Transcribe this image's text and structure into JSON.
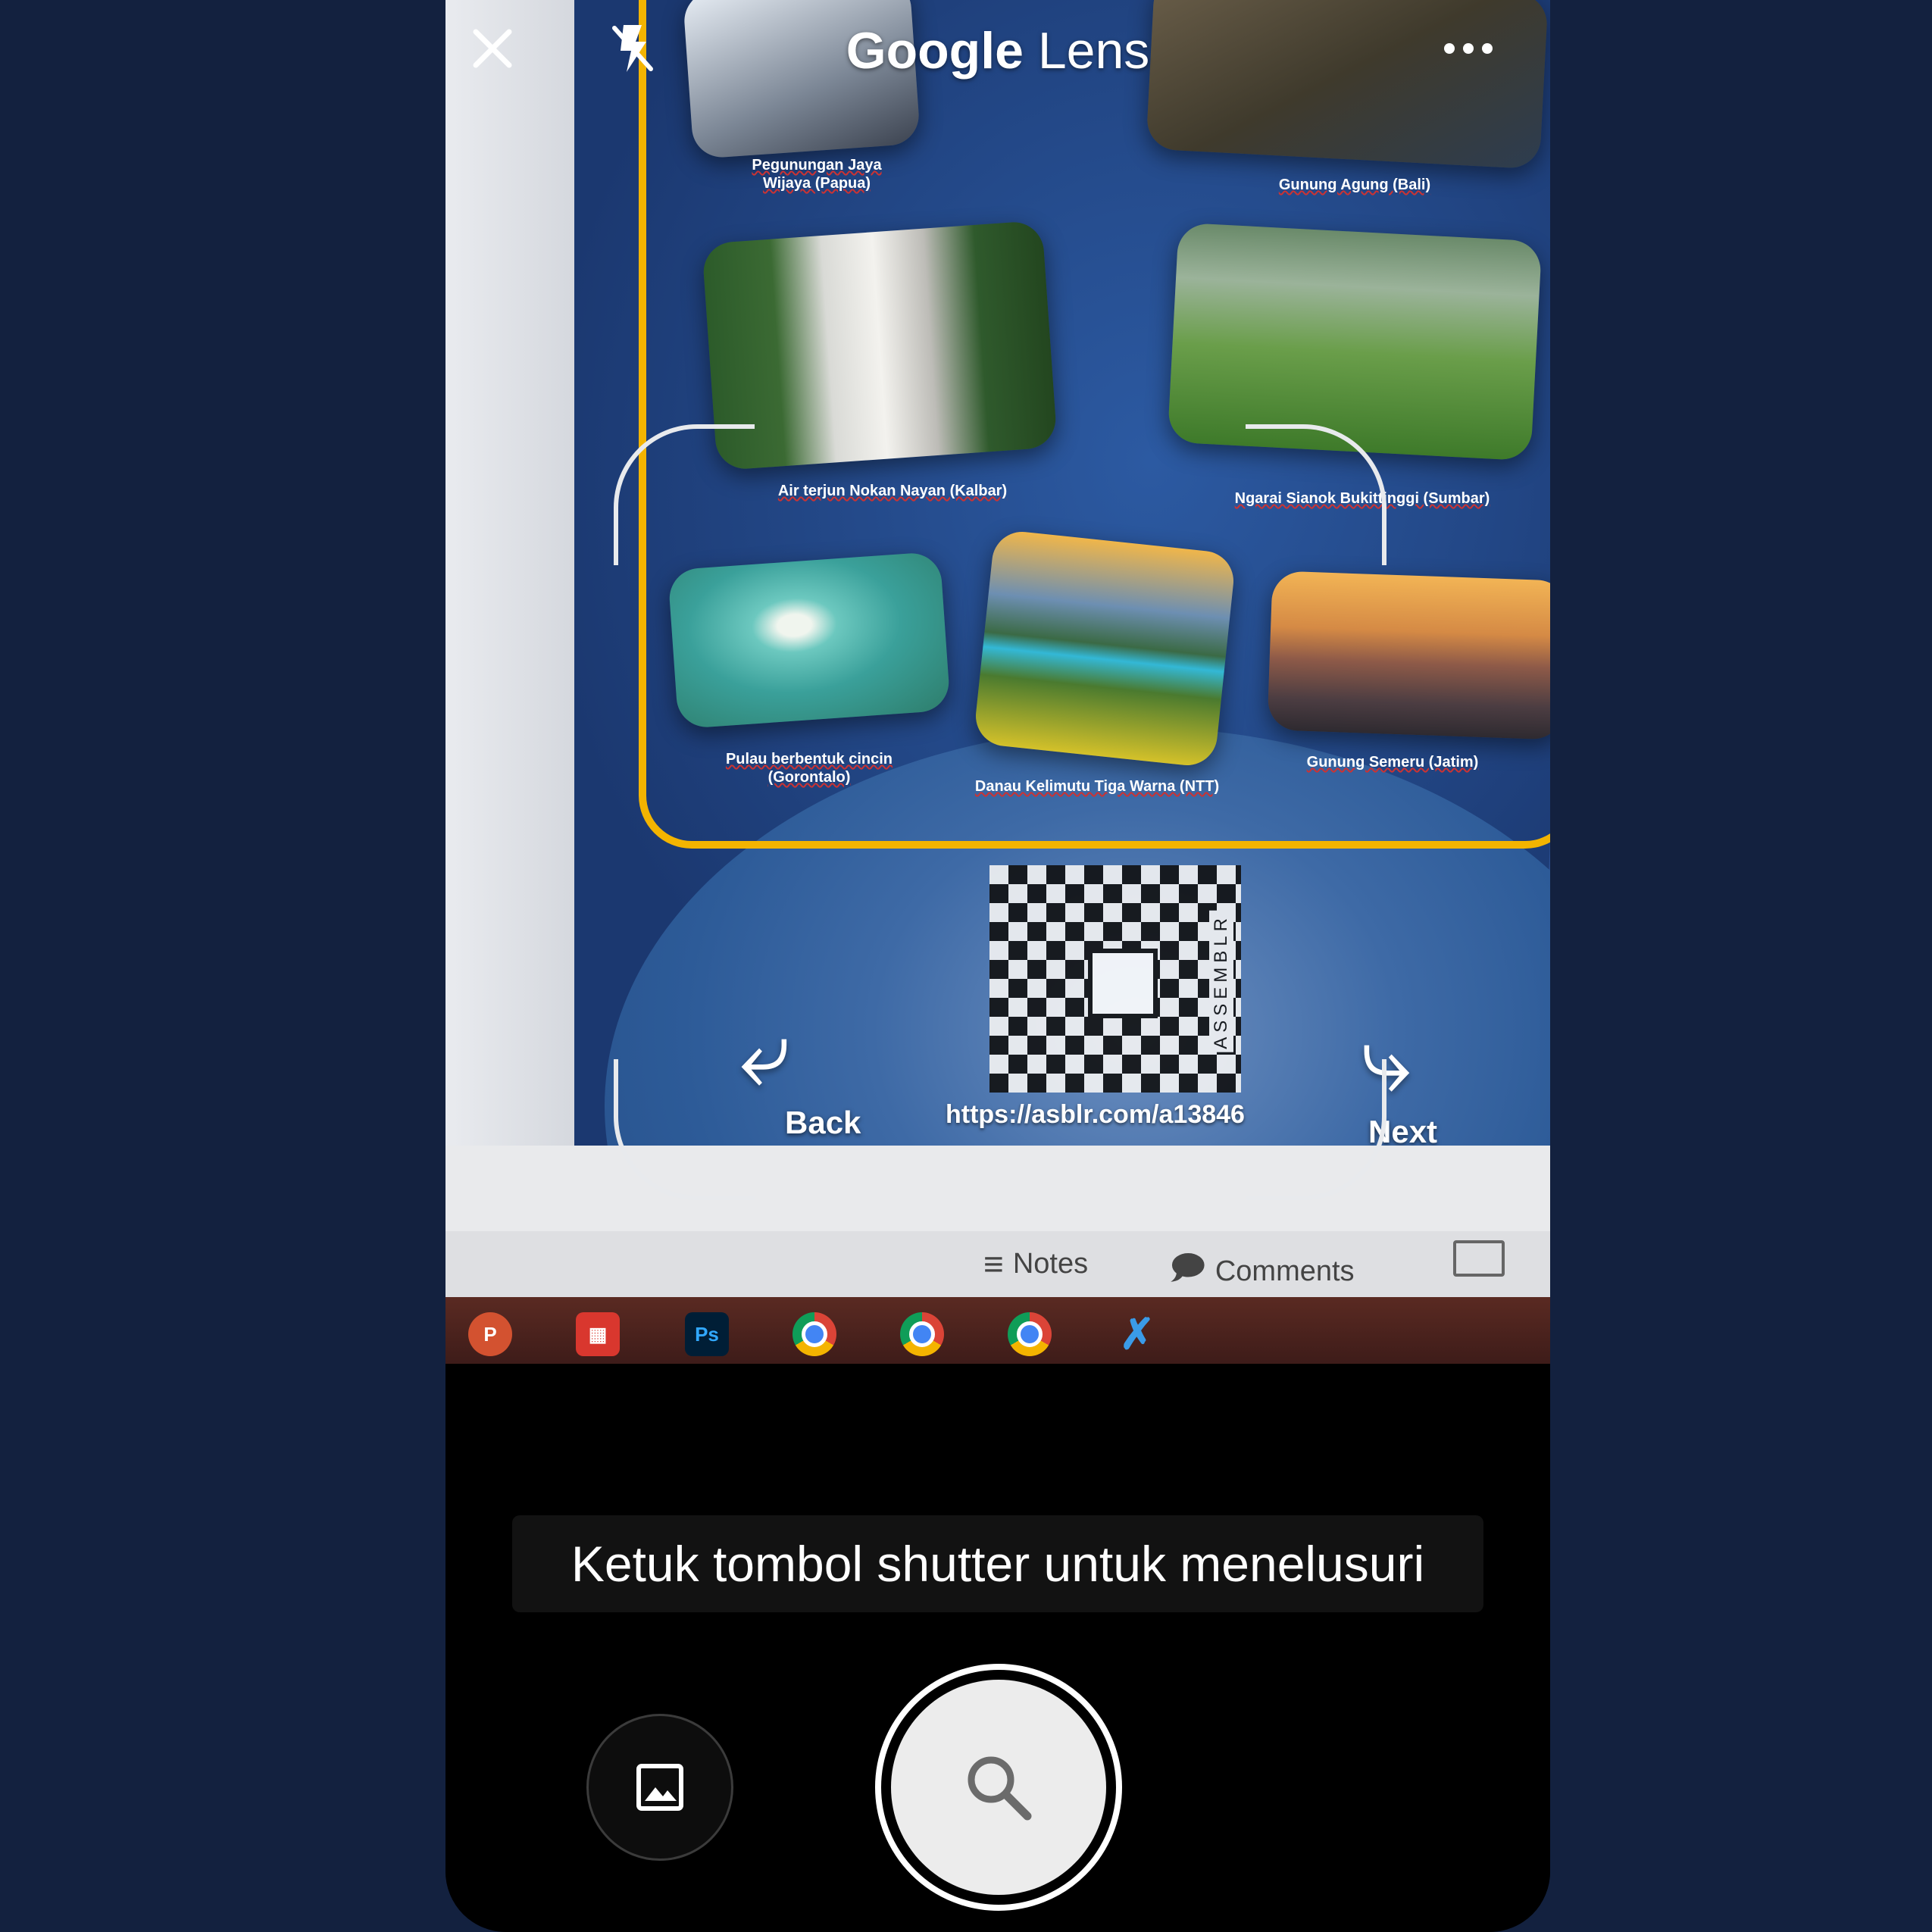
{
  "app": {
    "title_bold": "Google",
    "title_rest": " Lens"
  },
  "camera_scene": {
    "captions": [
      "Pegunungan Jaya Wijaya (Papua)",
      "Gunung Agung (Bali)",
      "Air terjun Nokan Nayan (Kalbar)",
      "Ngarai Sianok Bukittinggi (Sumbar)",
      "Pulau berbentuk cincin (Gorontalo)",
      "Danau Kelimutu Tiga Warna (NTT)",
      "Gunung Semeru (Jatim)"
    ],
    "qr_brand": "ASSEMBLR",
    "url": "https://asblr.com/a13846",
    "back_label": "Back",
    "next_label": "Next",
    "notes_label": "Notes",
    "comments_label": "Comments",
    "taskbar_ps": "Ps",
    "taskbar_p": "P"
  },
  "hint_text": "Ketuk tombol shutter untuk menelusuri",
  "icons": {
    "close": "close-icon",
    "flash_off": "flash-off-icon",
    "more": "more-icon",
    "gallery": "gallery-icon",
    "search": "search-icon"
  },
  "colors": {
    "page_bg": "#13213f",
    "accent_yellow": "#f3b400",
    "shutter": "#ececec"
  }
}
